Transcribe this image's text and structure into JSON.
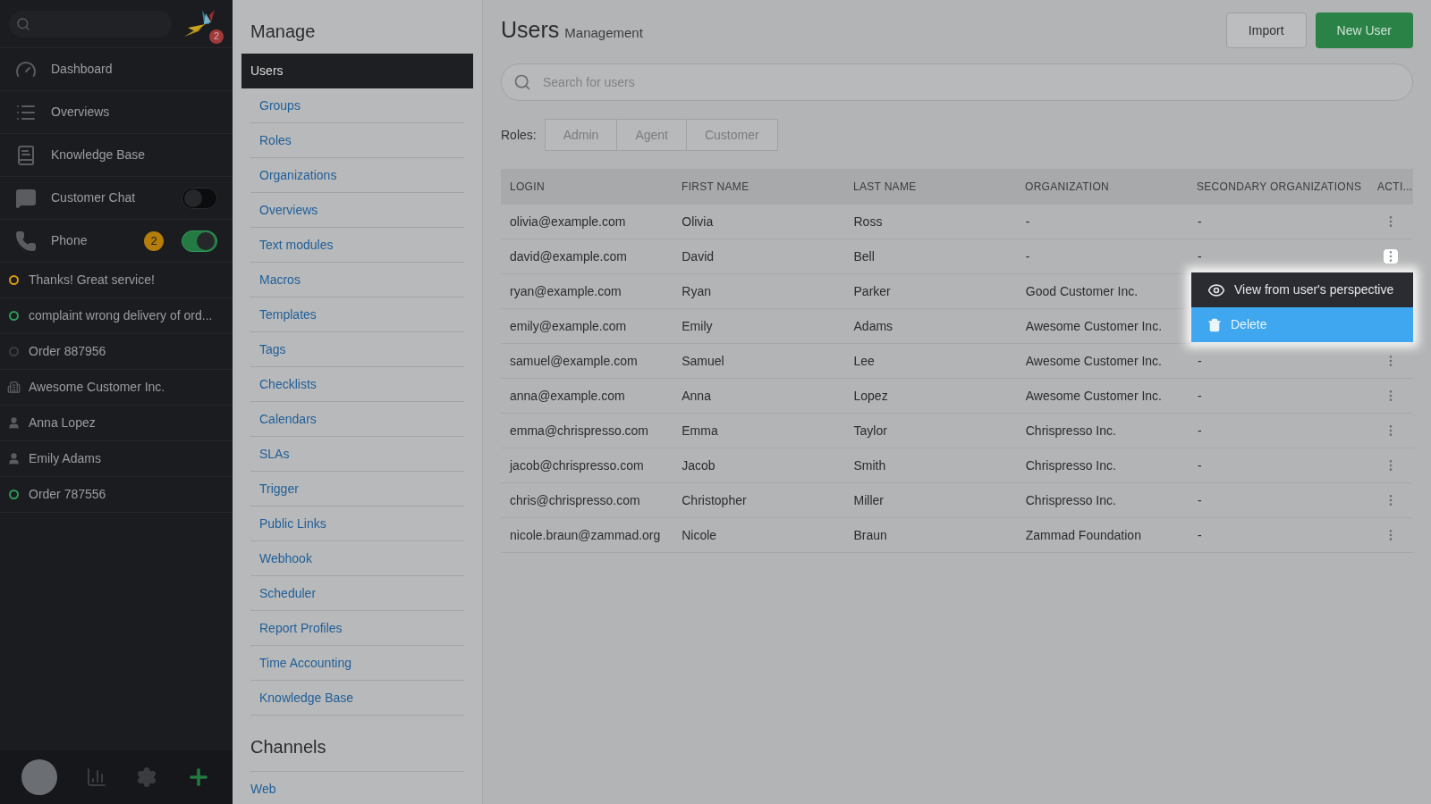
{
  "sidebar": {
    "logo_badge": "2",
    "nav": [
      {
        "label": "Dashboard"
      },
      {
        "label": "Overviews"
      },
      {
        "label": "Knowledge Base"
      },
      {
        "label": "Customer Chat",
        "toggle": {
          "on": false
        }
      },
      {
        "label": "Phone",
        "badge": "2",
        "toggle": {
          "on": true
        }
      }
    ],
    "tasks": [
      {
        "label": "Thanks! Great service!",
        "kind": "ticket",
        "color": "#d99a12"
      },
      {
        "label": "complaint wrong delivery of ord...",
        "kind": "ticket",
        "color": "#2f9a5a"
      },
      {
        "label": "Order 887956",
        "kind": "ticket",
        "color": "#3a3c40"
      },
      {
        "label": "Awesome Customer Inc.",
        "kind": "organization"
      },
      {
        "label": "Anna Lopez",
        "kind": "user"
      },
      {
        "label": "Emily Adams",
        "kind": "user"
      },
      {
        "label": "Order 787556",
        "kind": "ticket",
        "color": "#2f9a5a"
      }
    ]
  },
  "manage": {
    "heading": "Manage",
    "items": [
      {
        "label": "Users",
        "selected": true
      },
      {
        "label": "Groups",
        "selected": false
      },
      {
        "label": "Roles",
        "selected": false
      },
      {
        "label": "Organizations",
        "selected": false
      },
      {
        "label": "Overviews",
        "selected": false
      },
      {
        "label": "Text modules",
        "selected": false
      },
      {
        "label": "Macros",
        "selected": false
      },
      {
        "label": "Templates",
        "selected": false
      },
      {
        "label": "Tags",
        "selected": false
      },
      {
        "label": "Checklists",
        "selected": false
      },
      {
        "label": "Calendars",
        "selected": false
      },
      {
        "label": "SLAs",
        "selected": false
      },
      {
        "label": "Trigger",
        "selected": false
      },
      {
        "label": "Public Links",
        "selected": false
      },
      {
        "label": "Webhook",
        "selected": false
      },
      {
        "label": "Scheduler",
        "selected": false
      },
      {
        "label": "Report Profiles",
        "selected": false
      },
      {
        "label": "Time Accounting",
        "selected": false
      },
      {
        "label": "Knowledge Base",
        "selected": false
      }
    ],
    "channels_heading": "Channels",
    "channels": [
      "Web"
    ]
  },
  "main": {
    "title": "Users",
    "subtitle": "Management",
    "buttons": [
      {
        "label": "Import",
        "kind": "secondary"
      },
      {
        "label": "New User",
        "kind": "primary"
      }
    ],
    "search": {
      "placeholder": "Search for users"
    },
    "roles_label": "Roles:",
    "roles": [
      {
        "label": "Admin",
        "selected": false
      },
      {
        "label": "Agent",
        "selected": false
      },
      {
        "label": "Customer",
        "selected": false
      }
    ],
    "table": {
      "columns": [
        "LOGIN",
        "FIRST NAME",
        "LAST NAME",
        "ORGANIZATION",
        "SECONDARY ORGANIZATIONS",
        "ACTI..."
      ],
      "rows": [
        {
          "cells": [
            "olivia@example.com",
            "Olivia",
            "Ross",
            "-",
            "-"
          ],
          "menu_open": false
        },
        {
          "cells": [
            "david@example.com",
            "David",
            "Bell",
            "-",
            "-"
          ],
          "menu_open": true
        },
        {
          "cells": [
            "ryan@example.com",
            "Ryan",
            "Parker",
            "Good Customer Inc."
          ],
          "menu_open": false
        },
        {
          "cells": [
            "emily@example.com",
            "Emily",
            "Adams",
            "Awesome Customer Inc."
          ],
          "menu_open": false
        },
        {
          "cells": [
            "samuel@example.com",
            "Samuel",
            "Lee",
            "Awesome Customer Inc.",
            "-"
          ],
          "menu_open": false
        },
        {
          "cells": [
            "anna@example.com",
            "Anna",
            "Lopez",
            "Awesome Customer Inc.",
            "-"
          ],
          "menu_open": false
        },
        {
          "cells": [
            "emma@chrispresso.com",
            "Emma",
            "Taylor",
            "Chrispresso Inc.",
            "-"
          ],
          "menu_open": false
        },
        {
          "cells": [
            "jacob@chrispresso.com",
            "Jacob",
            "Smith",
            "Chrispresso Inc.",
            "-"
          ],
          "menu_open": false
        },
        {
          "cells": [
            "chris@chrispresso.com",
            "Christopher",
            "Miller",
            "Chrispresso Inc.",
            "-"
          ],
          "menu_open": false
        },
        {
          "cells": [
            "nicole.braun@zammad.org",
            "Nicole",
            "Braun",
            "Zammad Foundation",
            "-"
          ],
          "menu_open": false
        }
      ]
    },
    "action_menu": [
      {
        "label": "View from user's perspective",
        "kind": "view",
        "selected": false
      },
      {
        "label": "Delete",
        "kind": "delete",
        "selected": true
      }
    ]
  }
}
